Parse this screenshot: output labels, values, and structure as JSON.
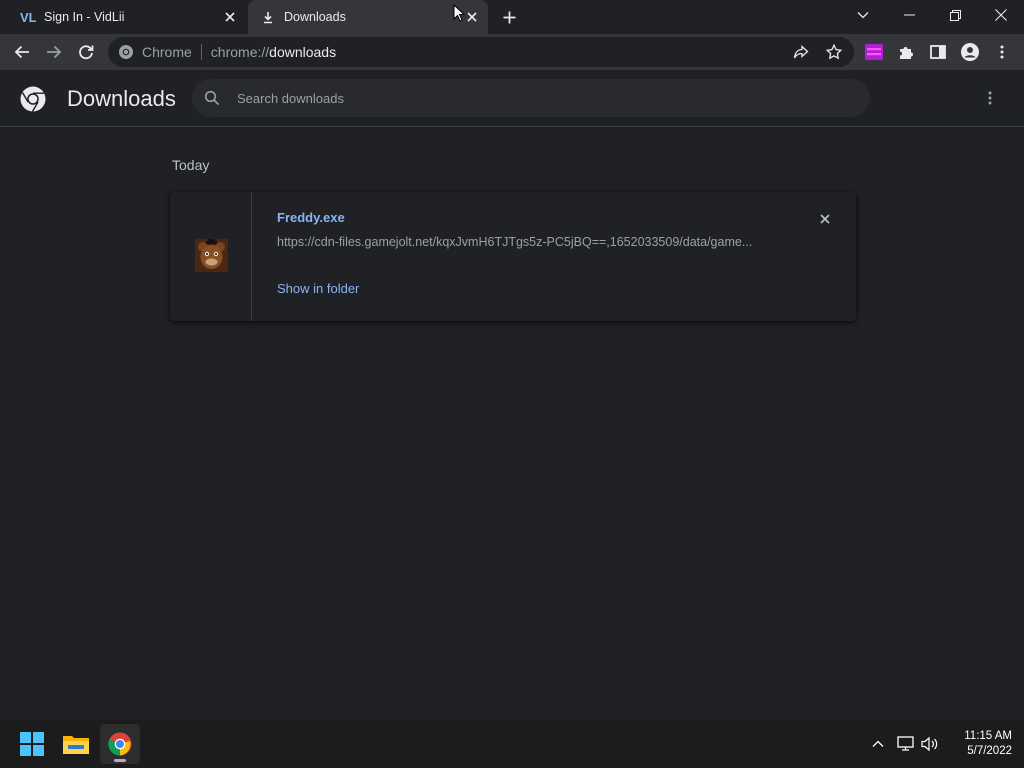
{
  "browser": {
    "tabs": [
      {
        "title": "Sign In - VidLii",
        "favicon": "vidlii-icon"
      },
      {
        "title": "Downloads",
        "favicon": "download-icon"
      }
    ],
    "omnibox": {
      "chip": "Chrome",
      "scheme": "chrome://",
      "host": "downloads"
    }
  },
  "page": {
    "title": "Downloads",
    "search_placeholder": "Search downloads",
    "date_header": "Today",
    "downloads": [
      {
        "filename": "Freddy.exe",
        "url": "https://cdn-files.gamejolt.net/kqxJvmH6TJTgs5z-PC5jBQ==,1652033509/data/game...",
        "action": "Show in folder"
      }
    ]
  },
  "taskbar": {
    "time": "11:15 AM",
    "date": "5/7/2022",
    "pinned": [
      "windows-start-icon",
      "file-explorer-icon",
      "chrome-icon"
    ]
  },
  "colors": {
    "link": "#8ab4f8",
    "background": "#202124",
    "toolbar": "#35363a"
  }
}
